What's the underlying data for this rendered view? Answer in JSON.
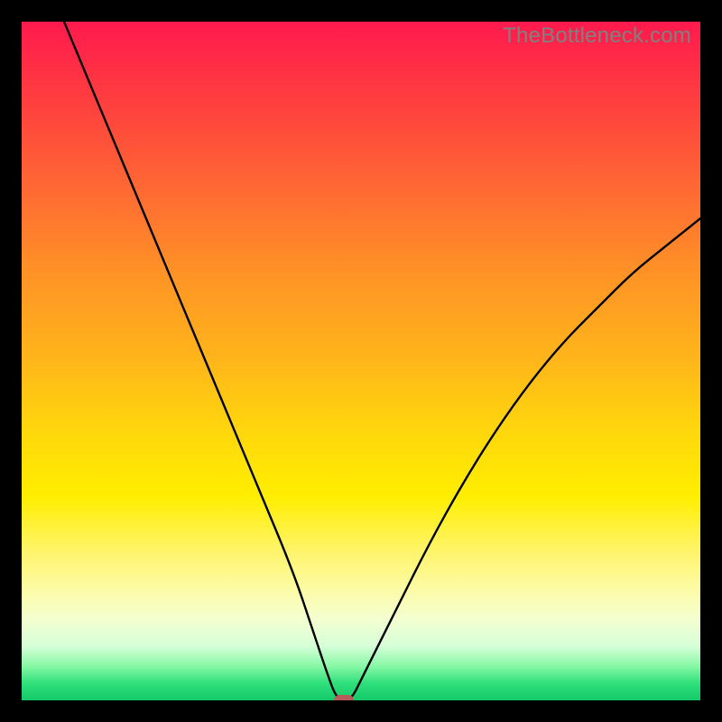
{
  "watermark": "TheBottleneck.com",
  "chart_data": {
    "type": "line",
    "title": "",
    "xlabel": "",
    "ylabel": "",
    "xlim": [
      0,
      100
    ],
    "ylim": [
      0,
      100
    ],
    "description": "V-shaped bottleneck curve over red-to-green vertical gradient. Minimum (optimal point) near x≈47 at y≈0. Left branch rises steeply to top-left corner; right branch rises and curves toward upper right, reaching ~74% height at right edge.",
    "series": [
      {
        "name": "bottleneck-curve",
        "x": [
          0,
          5,
          10,
          15,
          20,
          25,
          30,
          35,
          40,
          43,
          45,
          46.5,
          48.5,
          50,
          55,
          60,
          65,
          70,
          75,
          80,
          85,
          90,
          95,
          100
        ],
        "y": [
          115,
          103,
          91,
          79,
          67,
          55,
          43,
          31,
          19,
          10,
          4,
          0,
          0,
          3,
          13,
          23,
          32,
          40,
          47,
          53,
          58,
          63,
          67,
          71
        ]
      }
    ],
    "marker": {
      "x": 47.5,
      "y": 0,
      "color": "#b85a5a"
    },
    "gradient_stops": [
      {
        "pos": 0,
        "color": "#ff1a4d"
      },
      {
        "pos": 50,
        "color": "#ffd60d"
      },
      {
        "pos": 100,
        "color": "#14c96a"
      }
    ]
  }
}
